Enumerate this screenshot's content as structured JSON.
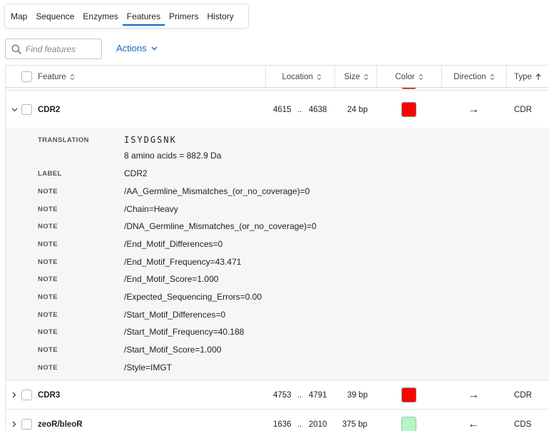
{
  "tabs": [
    {
      "label": "Map",
      "active": false
    },
    {
      "label": "Sequence",
      "active": false
    },
    {
      "label": "Enzymes",
      "active": false
    },
    {
      "label": "Features",
      "active": true
    },
    {
      "label": "Primers",
      "active": false
    },
    {
      "label": "History",
      "active": false
    }
  ],
  "search": {
    "placeholder": "Find features",
    "value": ""
  },
  "actions_label": "Actions",
  "columns": {
    "feature": "Feature",
    "location": "Location",
    "size": "Size",
    "color": "Color",
    "direction": "Direction",
    "type": "Type"
  },
  "colors": {
    "red": "#ff0000",
    "light_green": "#b8f5c4",
    "accent": "#1565c0"
  },
  "rows": [
    {
      "name": "CDR2",
      "start": "4615",
      "end": "4638",
      "sep": "..",
      "size": "24 bp",
      "color": "#ff0000",
      "direction": "→",
      "type": "CDR",
      "expanded": true
    },
    {
      "name": "CDR3",
      "start": "4753",
      "end": "4791",
      "sep": "..",
      "size": "39 bp",
      "color": "#ff0000",
      "direction": "→",
      "type": "CDR",
      "expanded": false
    },
    {
      "name": "zeoR/bleoR",
      "start": "1636",
      "end": "2010",
      "sep": "..",
      "size": "375 bp",
      "color": "#b8f5c4",
      "direction": "←",
      "type": "CDS",
      "expanded": false
    }
  ],
  "detail": {
    "translation_key": "TRANSLATION",
    "translation": "ISYDGSNK",
    "translation_info": "8 amino acids = 882.9 Da",
    "qualifiers": [
      {
        "key": "LABEL",
        "value": "CDR2"
      },
      {
        "key": "NOTE",
        "value": "/AA_Germline_Mismatches_(or_no_coverage)=0"
      },
      {
        "key": "NOTE",
        "value": "/Chain=Heavy"
      },
      {
        "key": "NOTE",
        "value": "/DNA_Germline_Mismatches_(or_no_coverage)=0"
      },
      {
        "key": "NOTE",
        "value": "/End_Motif_Differences=0"
      },
      {
        "key": "NOTE",
        "value": "/End_Motif_Frequency=43.471"
      },
      {
        "key": "NOTE",
        "value": "/End_Motif_Score=1.000"
      },
      {
        "key": "NOTE",
        "value": "/Expected_Sequencing_Errors=0.00"
      },
      {
        "key": "NOTE",
        "value": "/Start_Motif_Differences=0"
      },
      {
        "key": "NOTE",
        "value": "/Start_Motif_Frequency=40.188"
      },
      {
        "key": "NOTE",
        "value": "/Start_Motif_Score=1.000"
      },
      {
        "key": "NOTE",
        "value": "/Style=IMGT"
      }
    ]
  }
}
